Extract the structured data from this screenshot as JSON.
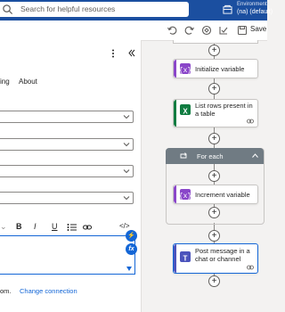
{
  "search": {
    "placeholder": "Search for helpful resources"
  },
  "environment": {
    "label": "Environments",
    "name": "(na) (default)"
  },
  "toolbar": {
    "save_label": "Save"
  },
  "panel": {
    "tabs": [
      "ing",
      "About"
    ],
    "format_buttons": [
      "B",
      "I",
      "U"
    ],
    "footer_text": "om.",
    "change_connection": "Change connection"
  },
  "flow": {
    "steps": [
      {
        "label": "Initialize variable",
        "icon": "variable-icon",
        "color": "#8a46c9"
      },
      {
        "label": "List rows present in a table",
        "icon": "excel-icon",
        "color": "#107c41"
      },
      {
        "label": "For each",
        "icon": "loop-icon",
        "color": "#707b83"
      },
      {
        "label": "Increment variable",
        "icon": "variable-icon",
        "color": "#8a46c9"
      },
      {
        "label": "Post message in a chat or channel",
        "icon": "teams-icon",
        "color": "#4b53bc"
      }
    ]
  },
  "colors": {
    "header": "#1b4fa0",
    "accent": "#1366d6"
  }
}
